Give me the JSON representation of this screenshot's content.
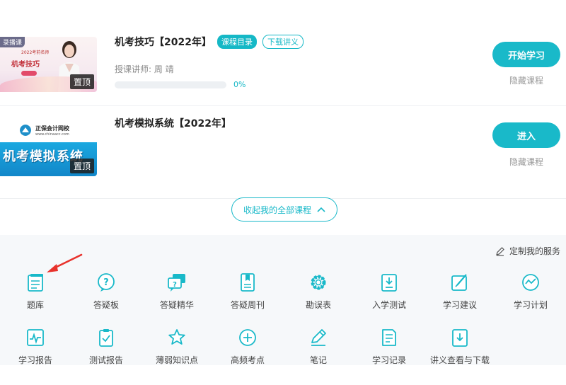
{
  "courses": [
    {
      "title": "机考技巧【2022年】",
      "tags": [
        "课程目录",
        "下载讲义"
      ],
      "teacher": "授课讲师:  周    靖",
      "progress_text": "0%",
      "progress_fraction": 0.0,
      "primary_label": "开始学习",
      "hide_label": "隐藏课程",
      "pin_label": "置顶",
      "thumb": {
        "badge": "录播课",
        "year": "2022考前名师",
        "name": "机考技巧",
        "tag": "名师"
      }
    },
    {
      "title": "机考模拟系统【2022年】",
      "primary_label": "进入",
      "hide_label": "隐藏课程",
      "pin_label": "置顶",
      "thumb": {
        "brand": "正保会计网校",
        "url": "www.chinaacc.com",
        "big": "机考模拟系统"
      }
    }
  ],
  "collapse_label": "收起我的全部课程",
  "customize_label": "定制我的服务",
  "services_row1": [
    {
      "label": "题库",
      "icon": "question-bank-icon"
    },
    {
      "label": "答疑板",
      "icon": "qa-board-icon"
    },
    {
      "label": "答疑精华",
      "icon": "qa-highlights-icon"
    },
    {
      "label": "答疑周刊",
      "icon": "qa-weekly-icon"
    },
    {
      "label": "勘误表",
      "icon": "errata-gear-icon"
    },
    {
      "label": "入学测试",
      "icon": "entrance-test-icon"
    },
    {
      "label": "学习建议",
      "icon": "study-advice-icon"
    },
    {
      "label": "学习计划",
      "icon": "study-plan-icon"
    }
  ],
  "services_row2": [
    {
      "label": "学习报告",
      "icon": "study-report-icon"
    },
    {
      "label": "测试报告",
      "icon": "test-report-icon"
    },
    {
      "label": "薄弱知识点",
      "icon": "weak-points-star-icon"
    },
    {
      "label": "高频考点",
      "icon": "high-frequency-plus-icon"
    },
    {
      "label": "笔记",
      "icon": "notes-pencil-icon"
    },
    {
      "label": "学习记录",
      "icon": "study-record-icon"
    },
    {
      "label": "讲义查看与下载",
      "icon": "handout-download-icon"
    }
  ],
  "colors": {
    "accent": "#19b9c9",
    "annotation_arrow": "#e8322c"
  }
}
